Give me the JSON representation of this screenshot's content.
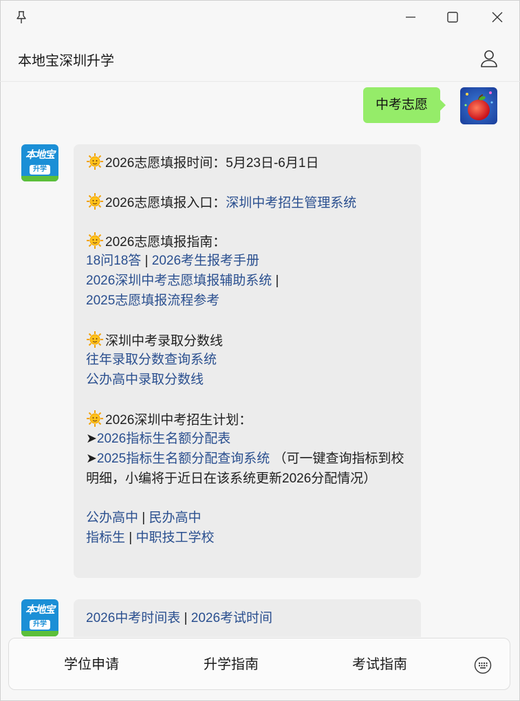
{
  "window": {
    "title": "本地宝深圳升学"
  },
  "user_message": {
    "text": "中考志愿"
  },
  "bot_avatar": {
    "logo_text": "本地宝",
    "tag_text": "升学"
  },
  "bot_message_1": {
    "timeline_prefix": "2026志愿填报时间：",
    "timeline_value": "5月23日-6月1日",
    "entry_prefix": "2026志愿填报入口：",
    "entry_link": "深圳中考招生管理系统",
    "guide_heading": "2026志愿填报指南：",
    "guide_link_1": "18问18答",
    "guide_link_2": "2026考生报考手册",
    "guide_link_3": "2026深圳中考志愿填报辅助系统",
    "guide_link_4": "2025志愿填报流程参考",
    "score_heading": "深圳中考录取分数线",
    "score_link_1": "往年录取分数查询系统",
    "score_link_2": "公办高中录取分数线",
    "plan_heading": "2026深圳中考招生计划：",
    "plan_link_1": "2026指标生名额分配表",
    "plan_link_2": "2025指标生名额分配查询系统",
    "plan_note": "（可一键查询指标到校明细，小编将于近日在该系统更新2026分配情况）",
    "school_link_1": "公办高中",
    "school_link_2": "民办高中",
    "school_link_3": "指标生",
    "school_link_4": "中职技工学校",
    "separator": " | ",
    "arrow": "➤"
  },
  "bot_message_2": {
    "link_1": "2026中考时间表",
    "link_2": "2026考试时间"
  },
  "bottom_menu": {
    "item_1": "学位申请",
    "item_2": "升学指南",
    "item_3": "考试指南"
  },
  "colors": {
    "user_bubble": "#95ec69",
    "bot_bubble": "#ececec",
    "link": "#2a4f8f",
    "background": "#f7f7f7"
  },
  "icons": [
    "pin-icon",
    "minimize-icon",
    "maximize-icon",
    "close-icon",
    "user-icon",
    "sun-emoji-icon",
    "keyboard-icon"
  ]
}
